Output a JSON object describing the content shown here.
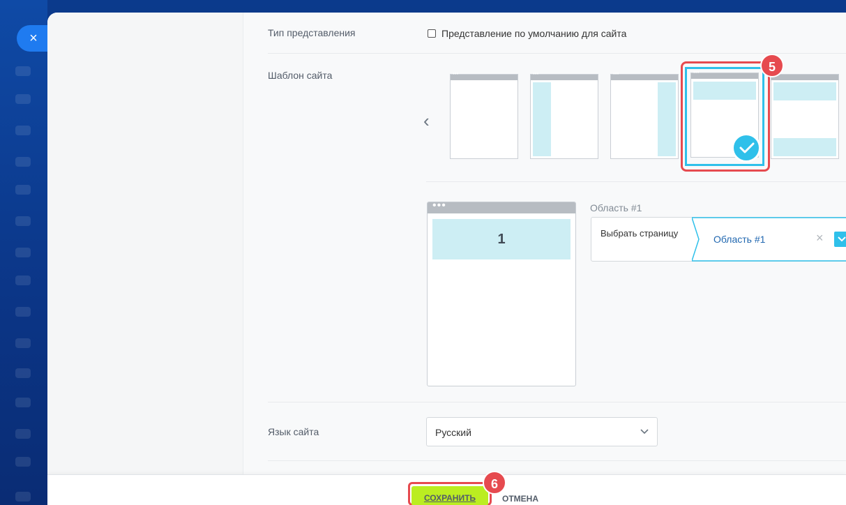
{
  "close_button": {
    "label": "×"
  },
  "form": {
    "view_type": {
      "label": "Тип представления",
      "checkbox_label": "Представление по умолчанию для сайта",
      "checked": false
    },
    "site_template": {
      "label": "Шаблон сайта",
      "templates": [
        "template-empty",
        "template-left-column",
        "template-right-column",
        "template-header",
        "template-header-footer"
      ],
      "selected_index": 3,
      "badge": "5"
    },
    "preview": {
      "dots": "•••",
      "area_number": "1"
    },
    "area": {
      "title": "Область #1",
      "choose_page": "Выбрать страницу",
      "value": "Область #1",
      "clear": "×"
    },
    "language": {
      "label": "Язык сайта",
      "value": "Русский"
    }
  },
  "footer": {
    "save_label": "СОХРАНИТЬ",
    "cancel_label": "ОТМЕНА",
    "badge": "6"
  },
  "colors": {
    "accent": "#2fc0ea",
    "highlight": "#e64a4f",
    "save": "#bbed21",
    "link": "#2067b0"
  }
}
